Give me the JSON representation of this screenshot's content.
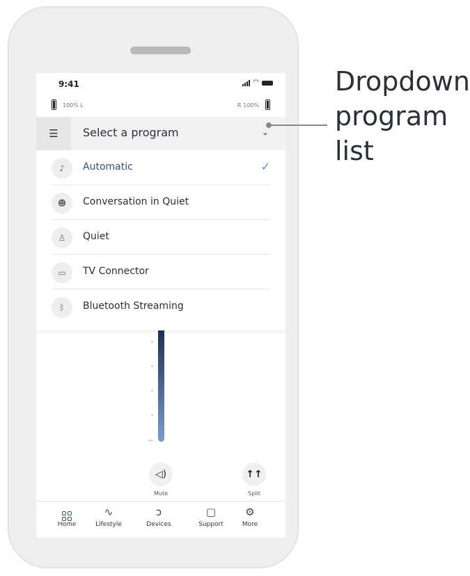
{
  "status_bar": {
    "time": "9:41"
  },
  "hearing_aids": {
    "left": {
      "percent": "100%",
      "side": "L",
      "level": 1.0
    },
    "right": {
      "percent": "100%",
      "side": "R",
      "level": 1.0
    }
  },
  "dropdown": {
    "title": "Select a program",
    "chevron": "⌄",
    "items": [
      {
        "label": "Automatic",
        "icon": "automatic-icon",
        "glyph": "♪",
        "selected": true
      },
      {
        "label": "Conversation in Quiet",
        "icon": "conversation-icon",
        "glyph": "☻",
        "selected": false
      },
      {
        "label": "Quiet",
        "icon": "quiet-icon",
        "glyph": "♙",
        "selected": false
      },
      {
        "label": "TV Connector",
        "icon": "tv-icon",
        "glyph": "▭",
        "selected": false
      },
      {
        "label": "Bluetooth Streaming",
        "icon": "bluetooth-icon",
        "glyph": "ᛒ",
        "selected": false
      }
    ],
    "check": "✓"
  },
  "controls": {
    "mute_label": "Mute",
    "split_label": "Split"
  },
  "bottom_nav": [
    {
      "label": "Home",
      "icon": "home-grid-icon",
      "active": true
    },
    {
      "label": "Lifestyle",
      "icon": "lifestyle-pulse-icon",
      "glyph": "∿",
      "active": false
    },
    {
      "label": "Devices",
      "icon": "devices-ear-icon",
      "glyph": "ↄ",
      "active": false
    },
    {
      "label": "Support",
      "icon": "support-chat-icon",
      "glyph": "▢",
      "active": false
    },
    {
      "label": "More",
      "icon": "more-gear-icon",
      "glyph": "⚙",
      "active": false
    }
  ],
  "annotation": {
    "lines": [
      "Dropdown",
      "program",
      "list"
    ]
  },
  "colors": {
    "selected_text": "#2f4e8a",
    "check": "#4a90d9",
    "slider_top": "#1d2e55",
    "slider_bottom": "#7a9cd6"
  }
}
